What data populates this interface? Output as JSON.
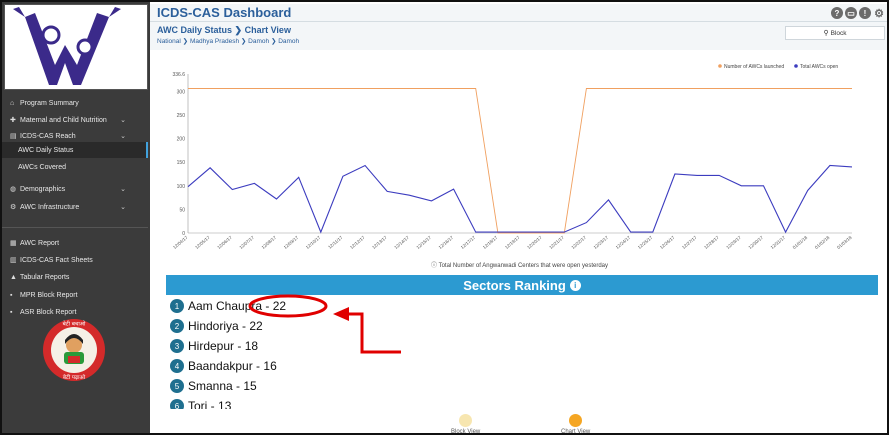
{
  "app": {
    "title": "ICDS-CAS Dashboard"
  },
  "header": {
    "page_title": "AWC Daily Status",
    "page_title_suffix": "Chart View",
    "breadcrumb": [
      "National",
      "Madhya Pradesh",
      "Damoh",
      "Damoh"
    ],
    "block_button": "Block",
    "icons": [
      "help-icon",
      "print-icon",
      "alert-icon",
      "settings-icon"
    ]
  },
  "sidebar": {
    "items": [
      {
        "label": "Program Summary",
        "icon": "home-icon"
      },
      {
        "label": "Maternal and Child Nutrition",
        "icon": "nutrition-icon",
        "expand": true
      },
      {
        "label": "ICDS-CAS Reach",
        "icon": "chart-icon",
        "expand": true
      },
      {
        "label": "AWC Daily Status",
        "active": true
      },
      {
        "label": "AWCs Covered"
      },
      {
        "label": "Demographics",
        "icon": "people-icon",
        "expand": true
      },
      {
        "label": "AWC Infrastructure",
        "icon": "building-icon",
        "expand": true
      },
      {
        "label": "AWC Report",
        "icon": "report-icon"
      },
      {
        "label": "ICDS-CAS Fact Sheets",
        "icon": "fact-sheet-icon"
      },
      {
        "label": "Tabular Reports",
        "icon": "table-icon"
      },
      {
        "label": "MPR Block Report",
        "icon": "mpr-icon"
      },
      {
        "label": "ASR Block Report",
        "icon": "asr-icon"
      }
    ],
    "seal_text": [
      "बेटी बचाओ",
      "बेटी पढ़ाओ"
    ]
  },
  "chart_data": {
    "type": "line",
    "ylim": [
      0,
      336.6
    ],
    "yticks": [
      0,
      50,
      100,
      150,
      200,
      250,
      300,
      336.6
    ],
    "x": [
      "12/04/17",
      "12/05/17",
      "12/06/17",
      "12/07/17",
      "12/08/17",
      "12/09/17",
      "12/10/17",
      "12/11/17",
      "12/12/17",
      "12/13/17",
      "12/14/17",
      "12/15/17",
      "12/16/17",
      "12/17/17",
      "12/18/17",
      "12/19/17",
      "12/20/17",
      "12/21/17",
      "12/22/17",
      "12/23/17",
      "12/24/17",
      "12/25/17",
      "12/26/17",
      "12/27/17",
      "12/28/17",
      "12/29/17",
      "12/30/17",
      "12/31/17",
      "01/01/18",
      "01/02/18",
      "01/03/18"
    ],
    "series": [
      {
        "name": "Number of AWCs launched",
        "color": "#f0a060",
        "values": [
          306,
          306,
          306,
          306,
          306,
          306,
          306,
          306,
          306,
          306,
          306,
          306,
          306,
          306,
          0,
          0,
          0,
          0,
          306,
          306,
          306,
          306,
          306,
          306,
          306,
          306,
          306,
          306,
          306,
          306,
          306
        ]
      },
      {
        "name": "Total AWCs open",
        "color": "#3c3cbf",
        "values": [
          98,
          138,
          92,
          105,
          72,
          118,
          2,
          120,
          143,
          88,
          80,
          68,
          93,
          2,
          2,
          2,
          2,
          2,
          22,
          70,
          2,
          2,
          125,
          122,
          122,
          100,
          100,
          2,
          90,
          143,
          140
        ]
      }
    ],
    "legend_position": "top-right",
    "note": "Total Number of Angwanwadi Centers that were open yesterday",
    "note_icon": "info-icon"
  },
  "ranking": {
    "title": "Sectors Ranking",
    "items": [
      {
        "rank": "1",
        "name": "Aam Chaupra",
        "value": "22"
      },
      {
        "rank": "2",
        "name": "Hindoriya",
        "value": "22"
      },
      {
        "rank": "3",
        "name": "Hirdepur",
        "value": "18"
      },
      {
        "rank": "4",
        "name": "Baandakpur",
        "value": "16"
      },
      {
        "rank": "5",
        "name": "Smanna",
        "value": "15"
      },
      {
        "rank": "6",
        "name": "Tori",
        "value": "13"
      }
    ]
  },
  "view_toggle": {
    "block": "Block View",
    "chart": "Chart View"
  },
  "colors": {
    "accent": "#2c9ad1",
    "sidebar": "#3b3b3b",
    "title": "#2b5f9b",
    "annotation": "#e00000"
  }
}
